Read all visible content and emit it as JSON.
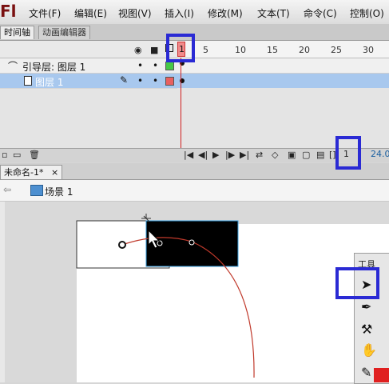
{
  "app": {
    "logo": "Fl"
  },
  "menu": [
    "文件(F)",
    "编辑(E)",
    "视图(V)",
    "插入(I)",
    "修改(M)",
    "文本(T)",
    "命令(C)",
    "控制(O)"
  ],
  "panel_tabs": {
    "timeline": "时间轴",
    "motion_editor": "动画编辑器"
  },
  "timeline": {
    "ruler_labels": [
      "1",
      "5",
      "10",
      "15",
      "20",
      "25",
      "30"
    ],
    "current_frame": "1",
    "layers": [
      {
        "name": "引导层: 图层 1",
        "type": "guide",
        "color": "#46c846"
      },
      {
        "name": "图层 1",
        "type": "normal",
        "color": "#e86060"
      }
    ],
    "frame_counter": "1",
    "fps": "24.00"
  },
  "document": {
    "tab_title": "未命名-1*",
    "close": "×",
    "scene": "场景 1"
  },
  "tools": {
    "title": "工具"
  },
  "colors": {
    "highlight": "#2a2ad4",
    "playhead": "#e86060",
    "selected_layer": "#a8c8ee",
    "path": "#c0392b"
  }
}
